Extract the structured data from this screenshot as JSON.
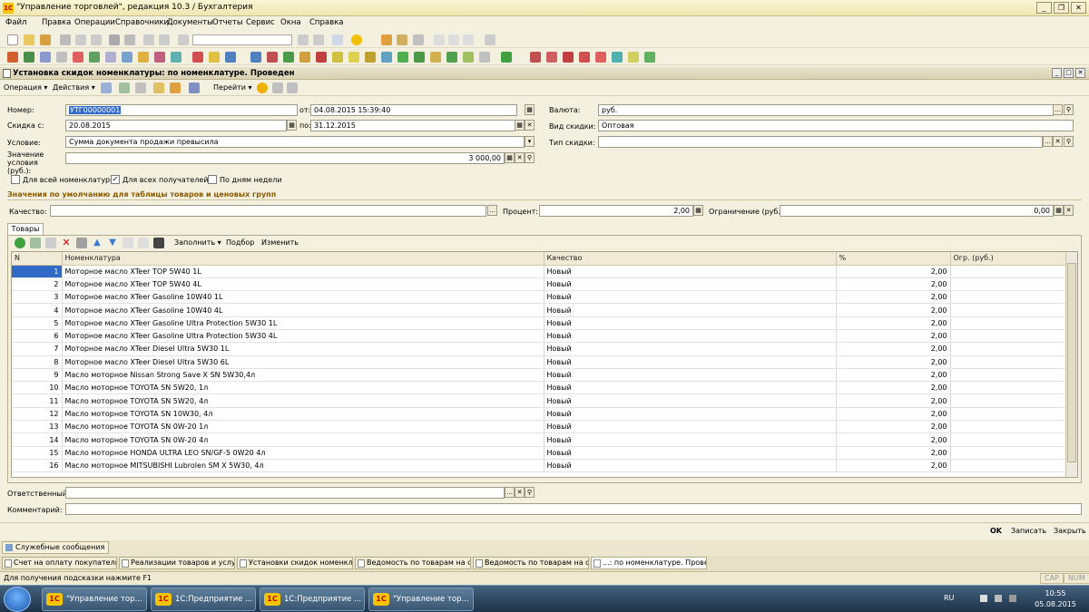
{
  "window": {
    "title": "\"Управление торговлей\", редакция 10.3 / Бухгалтерия"
  },
  "menu": [
    "Файл",
    "Правка",
    "Операции",
    "Справочники",
    "Документы",
    "Отчеты",
    "Сервис",
    "Окна",
    "Справка"
  ],
  "document": {
    "title": "Установка скидок номенклатуры: по номенклатуре. Проведен",
    "toolbar": {
      "operation": "Операция",
      "actions": "Действия",
      "goto": "Перейти"
    },
    "fields": {
      "number_label": "Номер:",
      "number": "УТГ00000001",
      "from_label": "от:",
      "from": "04.08.2015 15:39:40",
      "discount_from_label": "Скидка с:",
      "discount_from": "20.08.2015",
      "to_label": "по:",
      "to": "31.12.2015",
      "condition_label": "Условие:",
      "condition": "Сумма документа продажи превысила",
      "condition_value_label": "Значение условия (руб.):",
      "condition_value": "3 000,00",
      "currency_label": "Валюта:",
      "currency": "руб.",
      "discount_kind_label": "Вид скидки:",
      "discount_kind": "Оптовая",
      "discount_type_label": "Тип скидки:",
      "discount_type": ""
    },
    "checkboxes": [
      {
        "label": "Для всей номенклатуры",
        "checked": false
      },
      {
        "label": "Для всех получателей",
        "checked": true
      },
      {
        "label": "По дням недели",
        "checked": false
      }
    ],
    "defaults": {
      "header": "Значения по умолчанию для таблицы товаров и ценовых групп",
      "quality_label": "Качество:",
      "quality": "",
      "percent_label": "Процент:",
      "percent": "2,00",
      "limit_label": "Ограничение (руб.):",
      "limit": "0,00"
    },
    "tab": "Товары",
    "grid_toolbar": {
      "fill": "Заполнить",
      "select": "Подбор",
      "change": "Изменить"
    },
    "columns": [
      "N",
      "Номенклатура",
      "Качество",
      "%",
      "Огр. (руб.)"
    ],
    "rows": [
      {
        "n": "1",
        "name": "Моторное масло XTeer TOP 5W40 1L",
        "quality": "Новый",
        "pct": "2,00",
        "lim": ""
      },
      {
        "n": "2",
        "name": "Моторное масло XTeer TOP 5W40 4L",
        "quality": "Новый",
        "pct": "2,00",
        "lim": ""
      },
      {
        "n": "3",
        "name": "Моторное масло XTeer Gasoline 10W40 1L",
        "quality": "Новый",
        "pct": "2,00",
        "lim": ""
      },
      {
        "n": "4",
        "name": "Моторное масло XTeer Gasoline 10W40 4L",
        "quality": "Новый",
        "pct": "2,00",
        "lim": ""
      },
      {
        "n": "5",
        "name": "Моторное масло XTeer Gasoline Ultra Protection 5W30 1L",
        "quality": "Новый",
        "pct": "2,00",
        "lim": ""
      },
      {
        "n": "6",
        "name": "Моторное масло XTeer Gasoline Ultra Protection 5W30 4L",
        "quality": "Новый",
        "pct": "2,00",
        "lim": ""
      },
      {
        "n": "7",
        "name": "Моторное масло XTeer Diesel Ultra 5W30 1L",
        "quality": "Новый",
        "pct": "2,00",
        "lim": ""
      },
      {
        "n": "8",
        "name": "Моторное масло XTeer Diesel Ultra 5W30 6L",
        "quality": "Новый",
        "pct": "2,00",
        "lim": ""
      },
      {
        "n": "9",
        "name": "Масло моторное Nissan Strong Save X SN 5W30,4л",
        "quality": "Новый",
        "pct": "2,00",
        "lim": ""
      },
      {
        "n": "10",
        "name": "Масло моторное TOYOTA SN  5W20, 1л",
        "quality": "Новый",
        "pct": "2,00",
        "lim": ""
      },
      {
        "n": "11",
        "name": "Масло моторное TOYOTA SN  5W20, 4л",
        "quality": "Новый",
        "pct": "2,00",
        "lim": ""
      },
      {
        "n": "12",
        "name": "Масло моторное TOYOTA SN  10W30, 4л",
        "quality": "Новый",
        "pct": "2,00",
        "lim": ""
      },
      {
        "n": "13",
        "name": "Масло моторное TOYOTA SN 0W-20 1л",
        "quality": "Новый",
        "pct": "2,00",
        "lim": ""
      },
      {
        "n": "14",
        "name": "Масло моторное TOYOTA SN 0W-20 4л",
        "quality": "Новый",
        "pct": "2,00",
        "lim": ""
      },
      {
        "n": "15",
        "name": "Масло моторное HONDA ULTRA LEO SN/GF-5 0W20 4л",
        "quality": "Новый",
        "pct": "2,00",
        "lim": ""
      },
      {
        "n": "16",
        "name": "Масло моторное MITSUBISHI Lubrolen SM X 5W30, 4л",
        "quality": "Новый",
        "pct": "2,00",
        "lim": ""
      }
    ],
    "responsible_label": "Ответственный:",
    "responsible": "",
    "comment_label": "Комментарий:",
    "comment": "",
    "buttons": {
      "ok": "OK",
      "save": "Записать",
      "close": "Закрыть"
    }
  },
  "service_messages": "Служебные сообщения",
  "window_tabs": [
    {
      "label": "Счет на оплату покупателю",
      "active": false
    },
    {
      "label": "Реализации товаров и услуг",
      "active": false
    },
    {
      "label": "Установки скидок номенкл...",
      "active": false
    },
    {
      "label": "Ведомость по товарам на с...",
      "active": false
    },
    {
      "label": "Ведомость по товарам на с...",
      "active": false
    },
    {
      "label": "...: по номенклатуре. Прове...",
      "active": true
    }
  ],
  "status": {
    "hint": "Для получения подсказки нажмите F1",
    "cap": "CAP",
    "num": "NUM"
  },
  "taskbar": {
    "items": [
      "\"Управление тор...",
      "1С:Предприятие ...",
      "1С:Предприятие ...",
      "\"Управление тор..."
    ],
    "lang": "RU",
    "time": "10:55",
    "date": "05.08.2015"
  }
}
